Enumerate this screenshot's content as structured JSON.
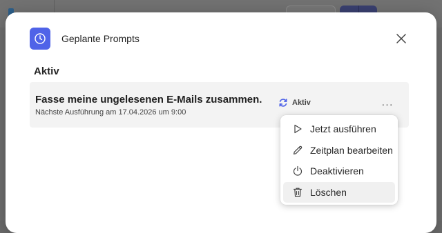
{
  "dialog": {
    "title": "Geplante Prompts",
    "section_heading": "Aktiv",
    "accent_color": "#4f63e8"
  },
  "prompt": {
    "title": "Fasse meine ungelesenen E-Mails zusammen.",
    "next_run": "Nächste Ausführung am 17.04.2026 um 9:00",
    "status": "Aktiv",
    "more_label": "···"
  },
  "menu": {
    "items": [
      {
        "label": "Jetzt ausführen",
        "icon": "play-icon"
      },
      {
        "label": "Zeitplan bearbeiten",
        "icon": "pencil-icon"
      },
      {
        "label": "Deaktivieren",
        "icon": "power-icon"
      },
      {
        "label": "Löschen",
        "icon": "trash-icon"
      }
    ]
  }
}
